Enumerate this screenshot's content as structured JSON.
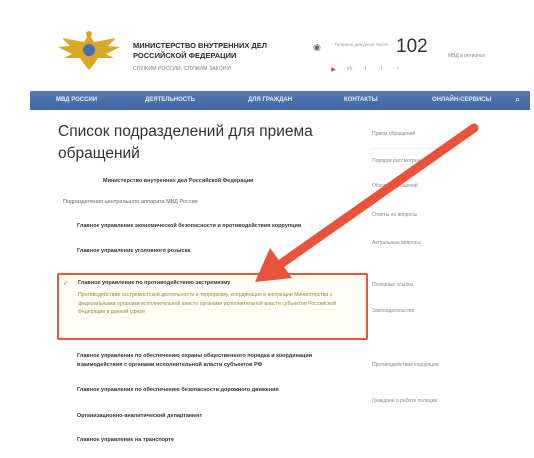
{
  "header": {
    "title_line1": "МИНИСТЕРСТВО ВНУТРЕННИХ ДЕЛ",
    "title_line2": "РОССИЙСКОЙ ФЕДЕРАЦИИ",
    "slogan": "СЛУЖИМ РОССИИ, СЛУЖИМ ЗАКОНУ!",
    "hotline": "102",
    "small_text": "Телефон дежурной части",
    "right_link": "МВД в регионах"
  },
  "nav": {
    "items": [
      "МВД РОССИИ",
      "ДЕЯТЕЛЬНОСТЬ",
      "ДЛЯ ГРАЖДАН",
      "КОНТАКТЫ",
      "ОНЛАЙН-СЕРВИСЫ"
    ]
  },
  "main": {
    "title": "Список подразделений для приема обращений",
    "ministry": "Министерство внутренних дел Российской Федерации",
    "section_label": "Подразделения центрального аппарата МВД России",
    "items_before": [
      "Главное управление экономической безопасности и противодействия коррупции",
      "Главное управление уголовного розыска"
    ],
    "highlighted": {
      "title": "Главное управление по противодействию экстремизму",
      "description": "Противодействие экстремистской деятельности и терроризму, координация в инстанции Министерства с федеральными органами исполнительной власти органами исполнительной власти субъектов Российской Федерации в данной сфере"
    },
    "items_after": [
      "Главное управление по обеспечению охраны общественного порядка и координации взаимодействия с органами исполнительной власти субъектов РФ",
      "Главное управление по обеспечению безопасности дорожного движения",
      "Организационно-аналитический департамент",
      "Главное управление на транспорте"
    ]
  },
  "sidebar": {
    "items": [
      "Прием обращений",
      "Порядок рассмотрения",
      "Обзоры обращений",
      "Ответы на вопросы",
      "Актуальные вопросы",
      "Полезные ссылки",
      "Законодательство",
      "Противодействие коррупции",
      "Граждане о работе полиции"
    ]
  },
  "colors": {
    "nav": "#4a70ae",
    "highlight_border": "#e55a3e",
    "arrow": "#e8533a"
  }
}
